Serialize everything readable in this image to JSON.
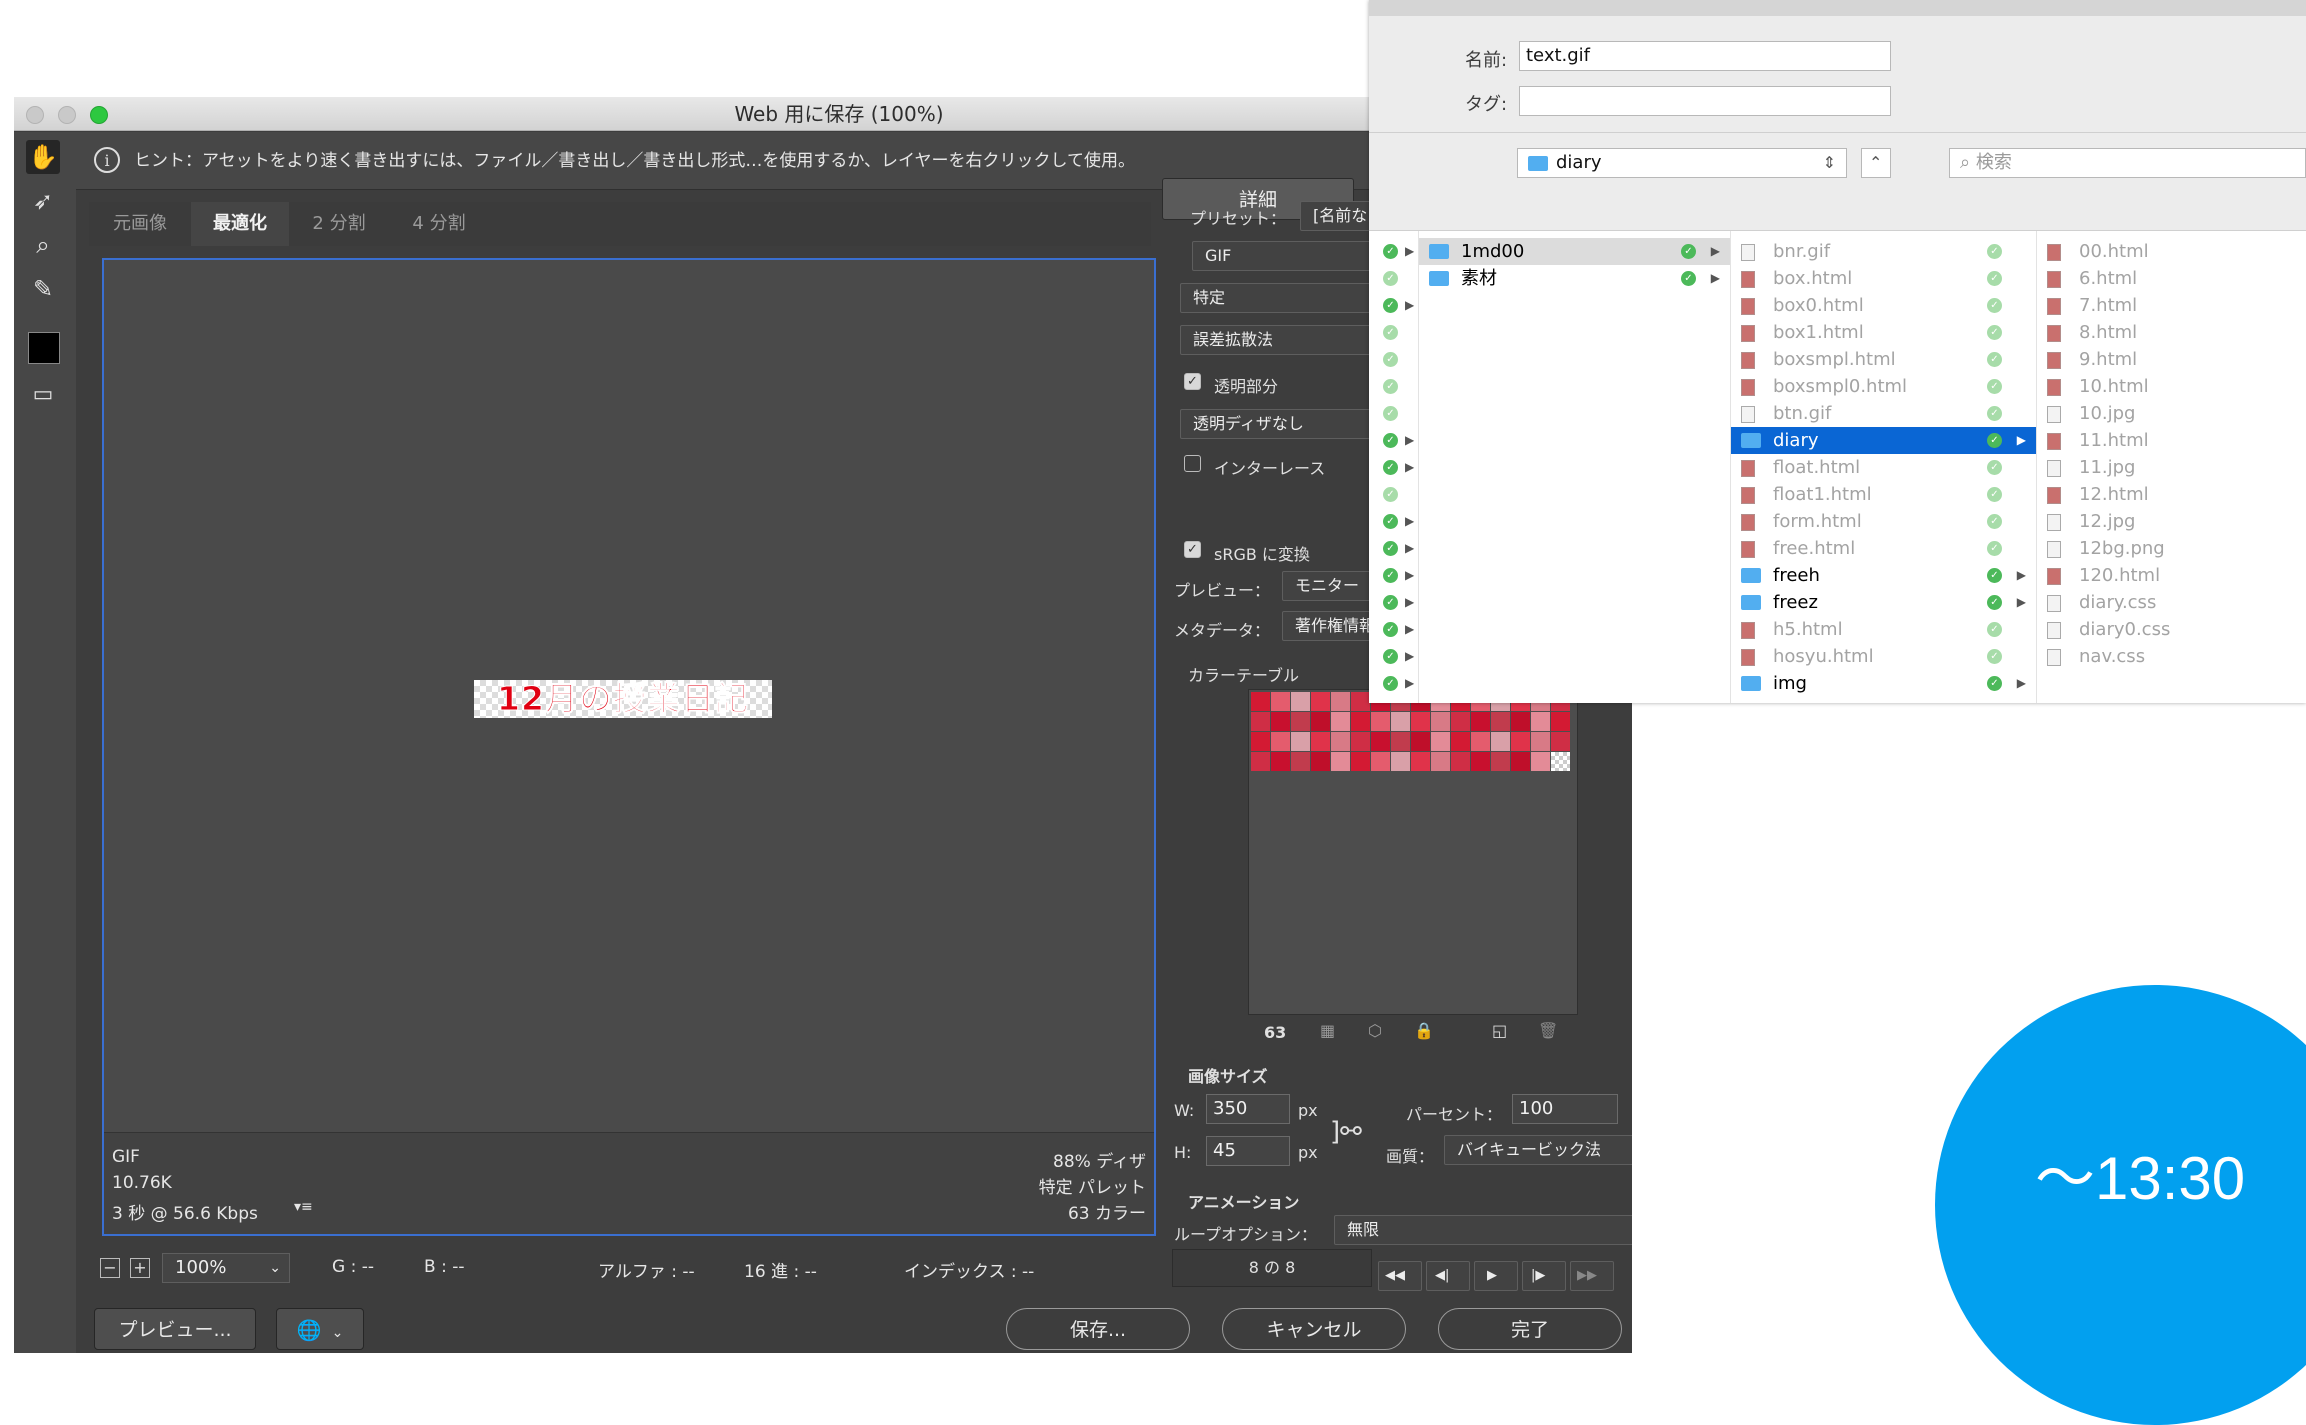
{
  "window": {
    "title": "Web 用に保存 (100%)",
    "hint": "ヒント：アセットをより速く書き出すには、ファイル／書き出し／書き出し形式…を使用するか、レイヤーを右クリックして使用。",
    "detail_button": "詳細",
    "tabs": [
      {
        "label": "元画像",
        "active": false
      },
      {
        "label": "最適化",
        "active": true
      },
      {
        "label": "2 分割",
        "active": false
      },
      {
        "label": "4 分割",
        "active": false
      }
    ],
    "preview_image_text": "12月の授業日記",
    "status_left": [
      "GIF",
      "10.76K",
      "3 秒 @ 56.6 Kbps"
    ],
    "status_right": [
      "88% ディザ",
      "特定 パレット",
      "63 カラー"
    ],
    "bottom_bar": {
      "zoom": "100%",
      "g": "G : --",
      "b": "B : --",
      "alpha": "アルファ : --",
      "hex": "16 進 : --",
      "index": "インデックス : --"
    },
    "buttons": {
      "preview": "プレビュー...",
      "save": "保存...",
      "cancel": "キャンセル",
      "done": "完了"
    }
  },
  "settings": {
    "preset_label": "プリセット：",
    "preset_value": "[名前な",
    "format": "GIF",
    "palette": "特定",
    "dither": "誤差拡散法",
    "transparency_label": "透明部分",
    "transparency_checked": true,
    "transparency_dither": "透明ディザなし",
    "interlace_label": "インターレース",
    "interlace_checked": false,
    "srgb_label": "sRGB に変換",
    "srgb_checked": true,
    "preview_label": "プレビュー：",
    "preview_value": "モニター",
    "metadata_label": "メタデータ：",
    "metadata_value": "著作権情報",
    "color_table_label": "カラーテーブル",
    "color_count": "63",
    "image_size_label": "画像サイズ",
    "w_label": "W:",
    "w_value": "350",
    "h_label": "H:",
    "h_value": "45",
    "unit": "px",
    "percent_label": "パーセント：",
    "percent_value": "100",
    "quality_label": "画質：",
    "quality_value": "バイキュービック法",
    "animation_label": "アニメーション",
    "loop_label": "ループオプション：",
    "loop_value": "無限",
    "frame_counter": "8 の 8",
    "swatch_colors": [
      "#d31a33",
      "#e0334a",
      "#c8102e",
      "#e38b97",
      "#d9a0a8",
      "#cf2e45",
      "#bf0f2a",
      "#e45c6d",
      "#d87a86",
      "#c13c4d"
    ]
  },
  "finder": {
    "name_label": "名前:",
    "name_value": "text.gif",
    "tag_label": "タグ:",
    "tag_value": "",
    "location": "diary",
    "search_placeholder": "検索",
    "col1": [
      {
        "name": "1md00",
        "type": "folder",
        "selected": true
      },
      {
        "name": "素材",
        "type": "folder",
        "selected": false
      }
    ],
    "col2": [
      {
        "name": "bnr.gif",
        "type": "gif"
      },
      {
        "name": "box.html",
        "type": "html"
      },
      {
        "name": "box0.html",
        "type": "html"
      },
      {
        "name": "box1.html",
        "type": "html"
      },
      {
        "name": "boxsmpl.html",
        "type": "html"
      },
      {
        "name": "boxsmpl0.html",
        "type": "html"
      },
      {
        "name": "btn.gif",
        "type": "gif"
      },
      {
        "name": "diary",
        "type": "folder",
        "selected": true
      },
      {
        "name": "float.html",
        "type": "html"
      },
      {
        "name": "float1.html",
        "type": "html"
      },
      {
        "name": "form.html",
        "type": "html"
      },
      {
        "name": "free.html",
        "type": "html"
      },
      {
        "name": "freeh",
        "type": "folder"
      },
      {
        "name": "freez",
        "type": "folder"
      },
      {
        "name": "h5.html",
        "type": "html"
      },
      {
        "name": "hosyu.html",
        "type": "html"
      },
      {
        "name": "img",
        "type": "folder"
      }
    ],
    "col3": [
      {
        "name": "00.html",
        "type": "html"
      },
      {
        "name": "6.html",
        "type": "html"
      },
      {
        "name": "7.html",
        "type": "html"
      },
      {
        "name": "8.html",
        "type": "html"
      },
      {
        "name": "9.html",
        "type": "html"
      },
      {
        "name": "10.html",
        "type": "html"
      },
      {
        "name": "10.jpg",
        "type": "jpg"
      },
      {
        "name": "11.html",
        "type": "html"
      },
      {
        "name": "11.jpg",
        "type": "jpg"
      },
      {
        "name": "12.html",
        "type": "html"
      },
      {
        "name": "12.jpg",
        "type": "jpg"
      },
      {
        "name": "12bg.png",
        "type": "png"
      },
      {
        "name": "120.html",
        "type": "html"
      },
      {
        "name": "diary.css",
        "type": "css"
      },
      {
        "name": "diary0.css",
        "type": "css"
      },
      {
        "name": "nav.css",
        "type": "css"
      }
    ]
  },
  "overlay": {
    "time": "～13:30",
    "color": "#02a0ef"
  }
}
